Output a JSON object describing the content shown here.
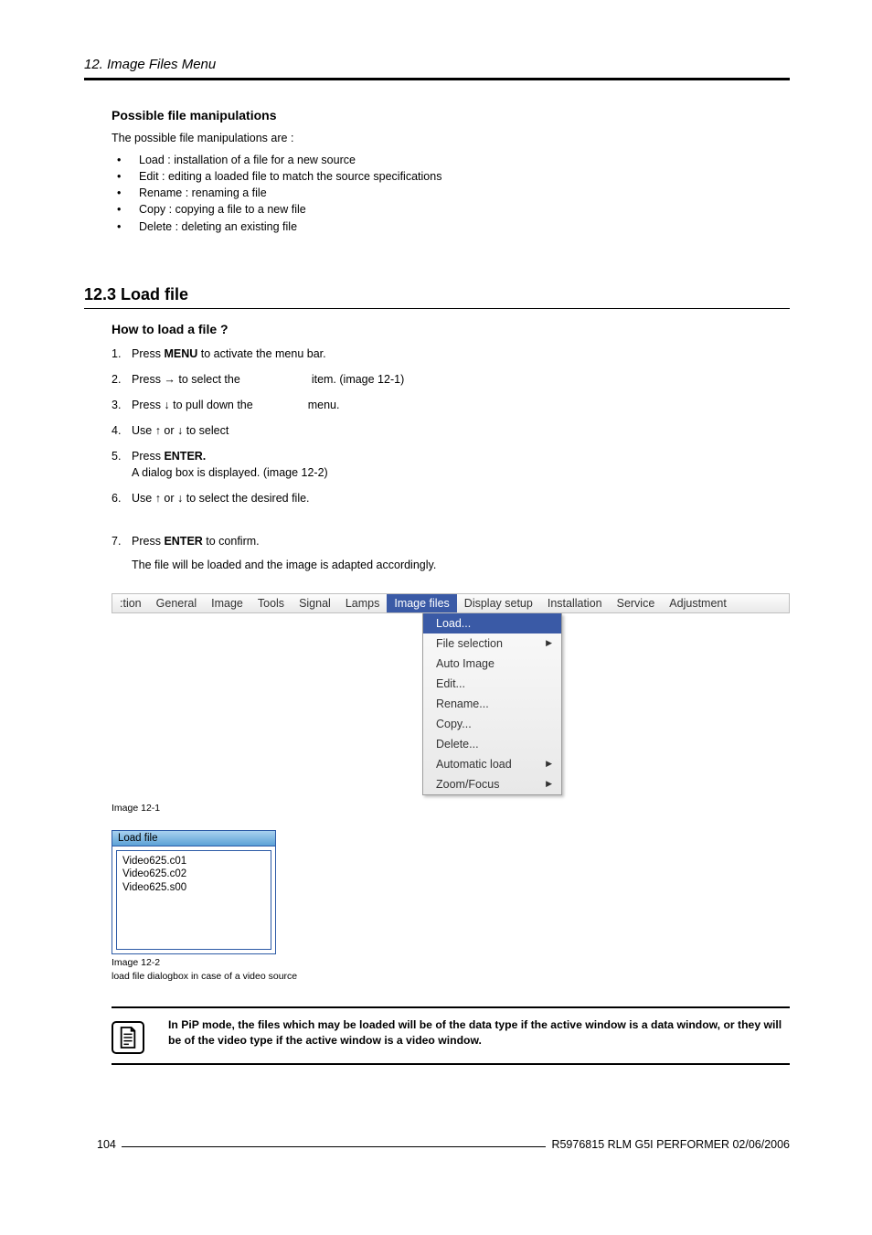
{
  "header": {
    "chapter": "12. Image Files Menu"
  },
  "sec1": {
    "title": "Possible file manipulations",
    "intro": "The possible file manipulations are :",
    "items": [
      "Load : installation of a file for a new source",
      "Edit : editing a loaded file to match the source specifications",
      "Rename : renaming a file",
      "Copy : copying a file to a new file",
      "Delete : deleting an existing file"
    ]
  },
  "sec2": {
    "number_title": "12.3 Load file",
    "subtitle": "How to load a file ?",
    "steps": {
      "s1a": "Press ",
      "s1b": "MENU",
      "s1c": " to activate the menu bar.",
      "s2": "Press → to select the",
      "s2b": "item. (image 12-1)",
      "s3": "Press ↓ to pull down the",
      "s3b": "menu.",
      "s4": "Use ↑ or ↓ to select",
      "s5a": "Press ",
      "s5b": "ENTER.",
      "s5c": "A dialog box is displayed. (image 12-2)",
      "s6": "Use ↑ or ↓ to select the desired file.",
      "s7a": "Press ",
      "s7b": "ENTER",
      "s7c": " to confirm.",
      "s7d": "The file will be loaded and the image is adapted accordingly."
    }
  },
  "menubar": {
    "items": [
      ":tion",
      "General",
      "Image",
      "Tools",
      "Signal",
      "Lamps",
      "Image files",
      "Display setup",
      "Installation",
      "Service",
      "Adjustment"
    ],
    "selected": "Image files"
  },
  "dropdown": {
    "items": [
      {
        "label": "Load...",
        "sel": true,
        "arrow": false
      },
      {
        "label": "File selection",
        "sel": false,
        "arrow": true
      },
      {
        "label": "Auto Image",
        "sel": false,
        "arrow": false
      },
      {
        "label": "Edit...",
        "sel": false,
        "arrow": false
      },
      {
        "label": "Rename...",
        "sel": false,
        "arrow": false
      },
      {
        "label": "Copy...",
        "sel": false,
        "arrow": false
      },
      {
        "label": "Delete...",
        "sel": false,
        "arrow": false
      },
      {
        "label": "Automatic load",
        "sel": false,
        "arrow": true
      },
      {
        "label": "Zoom/Focus",
        "sel": false,
        "arrow": true
      }
    ]
  },
  "fig1_caption": "Image 12-1",
  "dialog": {
    "title": "Load file",
    "files": [
      "Video625.c01",
      "Video625.c02",
      "Video625.s00"
    ]
  },
  "fig2_caption_a": "Image 12-2",
  "fig2_caption_b": "load file dialogbox in case of a video source",
  "note": "In PiP mode, the files which may be loaded will be of the data type if the active window is a data window, or they will be of the video type if the active window is a video window.",
  "footer": {
    "page": "104",
    "doc": "R5976815 RLM G5I PERFORMER 02/06/2006"
  }
}
